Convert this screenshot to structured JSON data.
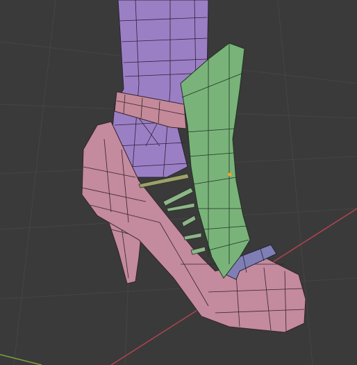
{
  "viewport": {
    "background": "#3a3a3a",
    "grid_color": "#444444",
    "x_axis_color": "#b0444f",
    "y_axis_color": "#7fa23a"
  },
  "objects": [
    {
      "name": "leg",
      "color": "#9b7fc4",
      "wire": "#2b2238"
    },
    {
      "name": "ankle-strap",
      "color": "#c48a9a",
      "wire": "#33232a"
    },
    {
      "name": "shoe",
      "color": "#c48a9e",
      "wire": "#33232a"
    },
    {
      "name": "heel",
      "color": "#c48a9e",
      "wire": "#33232a"
    },
    {
      "name": "front-panel",
      "color": "#79b37a",
      "wire": "#1f3320",
      "selected": true
    },
    {
      "name": "toe-strap",
      "color": "#7f7fb5",
      "wire": "#24243a"
    },
    {
      "name": "laces",
      "color": "#8fb58a",
      "wire": "#24331f"
    }
  ],
  "origin_point_color": "#ffa020"
}
